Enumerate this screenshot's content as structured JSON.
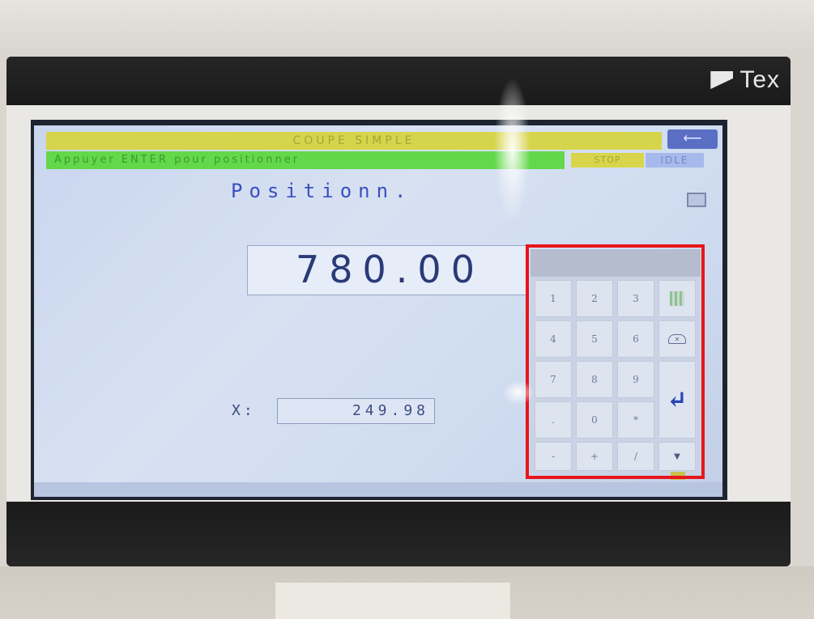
{
  "brand": {
    "name": "Tex"
  },
  "header": {
    "title": "COUPE SIMPLE",
    "status_message": "Appuyer ENTER pour positionner",
    "stop_label": "STOP",
    "state_label": "IDLE",
    "back_label": "⟵"
  },
  "main": {
    "mode_title": "Positionn.",
    "target_value": "780.00",
    "x_label": "X:",
    "x_value": "249.98"
  },
  "keypad": {
    "keys": [
      "1",
      "2",
      "3",
      "4",
      "5",
      "6",
      "7",
      "8",
      "9",
      ".",
      "0",
      "*",
      "-",
      "+",
      "/"
    ],
    "enter_icon": "enter-icon",
    "clear_icon": "backspace-icon",
    "grid_icon": "grid-icon",
    "scroll_icon": "scroll-down-icon"
  },
  "colors": {
    "title_bar": "#d6d44a",
    "status_bar": "#63d84a",
    "accent": "#3a4fc0",
    "highlight": "#e8151b"
  }
}
